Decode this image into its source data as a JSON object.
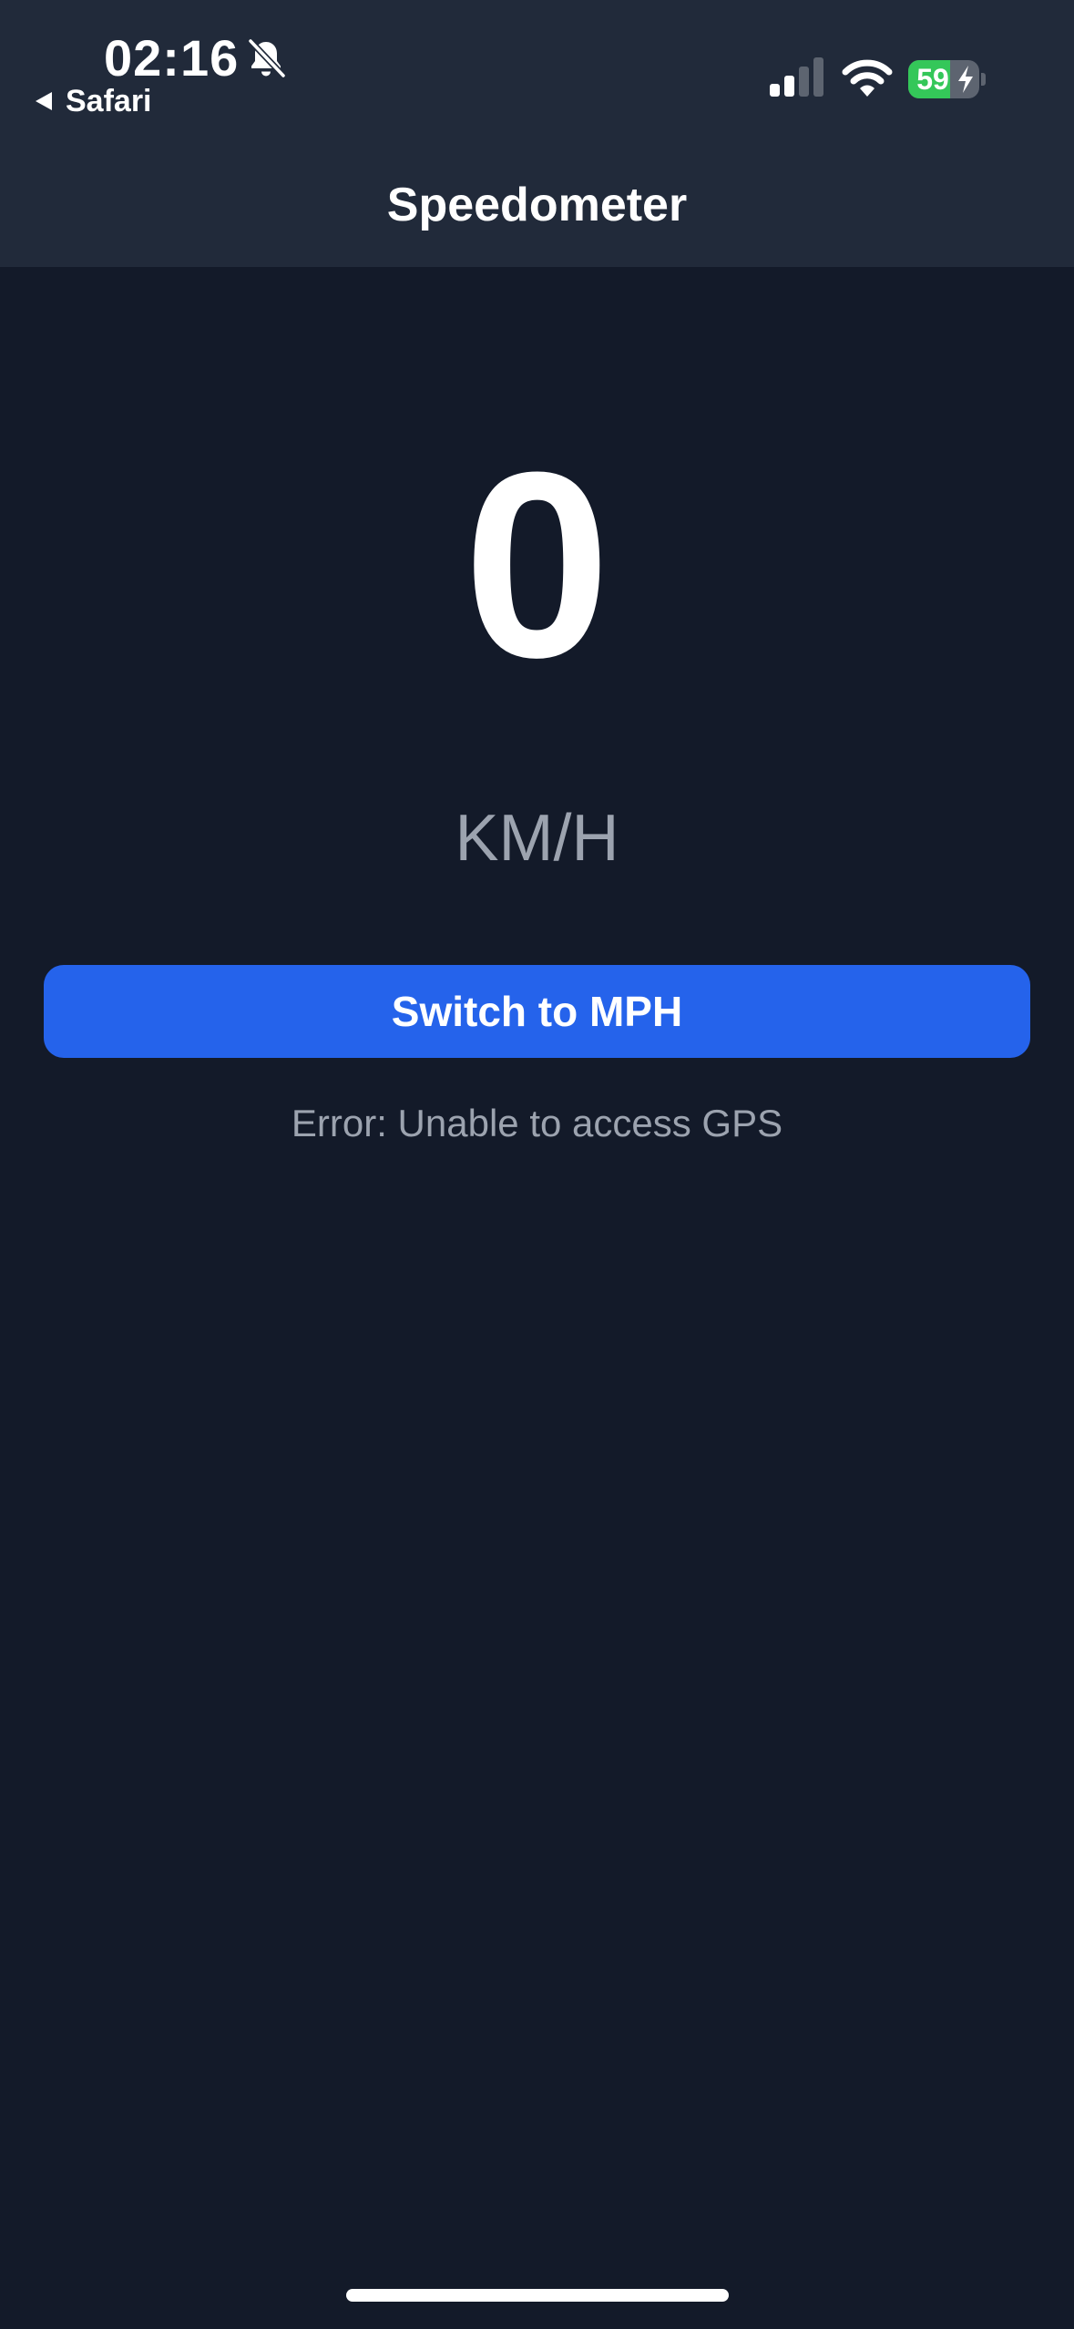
{
  "status_bar": {
    "time": "02:16",
    "back_app": "Safari",
    "battery_level": "59",
    "battery_charging": true,
    "battery_fraction": 0.59,
    "signal_bars_active": 2,
    "signal_bars_total": 4,
    "silent_mode": true
  },
  "header": {
    "title": "Speedometer"
  },
  "speed": {
    "value": "0",
    "unit": "KM/H"
  },
  "actions": {
    "toggle_unit_label": "Switch to MPH"
  },
  "status": {
    "error": "Error: Unable to access GPS"
  },
  "colors": {
    "background": "#131a29",
    "header_background": "#212a3a",
    "accent": "#2563eb",
    "muted_text": "#9ca3af",
    "battery_green": "#34c759"
  }
}
